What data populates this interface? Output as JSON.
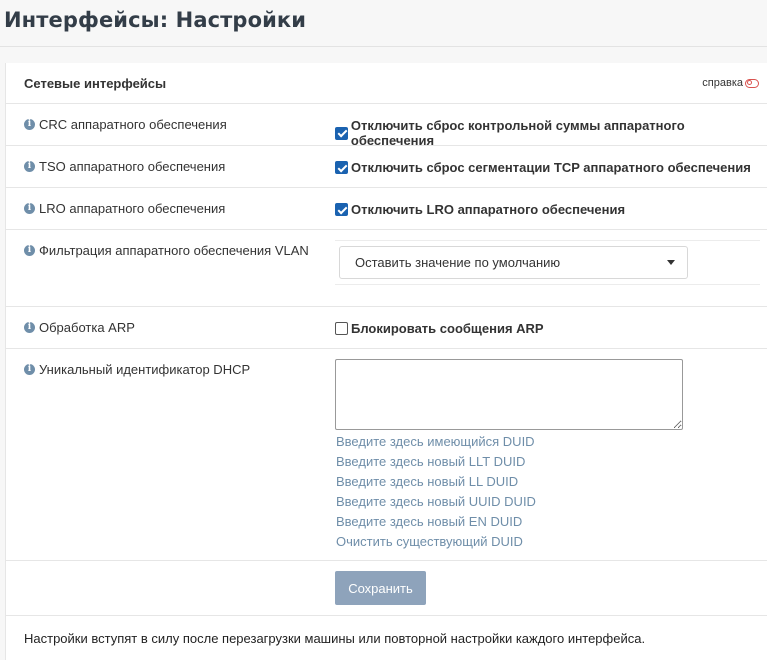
{
  "page": {
    "title": "Интерфейсы: Настройки"
  },
  "panel": {
    "title": "Сетевые интерфейсы",
    "help_label": "справка"
  },
  "rows": {
    "crc": {
      "label": "CRC аппаратного обеспечения",
      "checkbox_label": "Отключить сброс контрольной суммы аппаратного обеспечения",
      "checked": true
    },
    "tso": {
      "label": "TSO аппаратного обеспечения",
      "checkbox_label": "Отключить сброс сегментации TCP аппаратного обеспечения",
      "checked": true
    },
    "lro": {
      "label": "LRO аппаратного обеспечения",
      "checkbox_label": "Отключить LRO аппаратного обеспечения",
      "checked": true
    },
    "vlan": {
      "label": "Фильтрация аппаратного обеспечения VLAN",
      "selected": "Оставить значение по умолчанию"
    },
    "arp": {
      "label": "Обработка ARP",
      "checkbox_label": "Блокировать сообщения ARP",
      "checked": false
    },
    "duid": {
      "label": "Уникальный идентификатор DHCP",
      "value": "",
      "links": [
        "Введите здесь имеющийся DUID",
        "Введите здесь новый LLT DUID",
        "Введите здесь новый LL DUID",
        "Введите здесь новый UUID DUID",
        "Введите здесь новый EN DUID",
        "Очистить существующий DUID"
      ]
    }
  },
  "save_label": "Сохранить",
  "footer_note": "Настройки вступят в силу после перезагрузки машины или повторной настройки каждого интерфейса.",
  "colors": {
    "accent": "#1a62b0",
    "link": "#6f8ea9",
    "button": "#8ea3bb",
    "help_toggle": "#d9534f"
  },
  "icons": {
    "info": "info-circle-icon",
    "help": "toggle-off-icon",
    "caret": "caret-down-icon"
  }
}
